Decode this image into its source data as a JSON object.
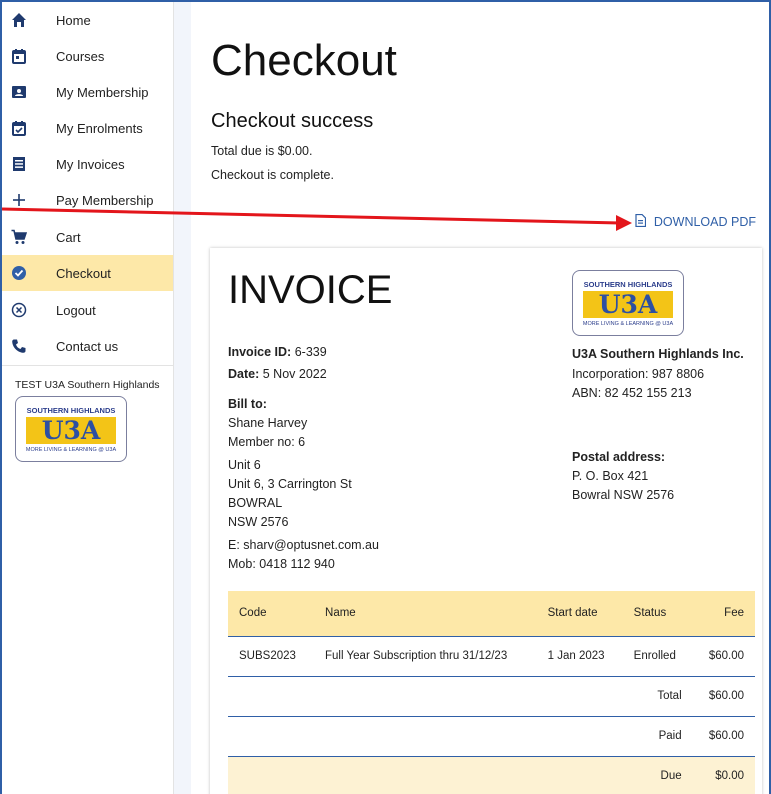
{
  "sidebar": {
    "items": [
      {
        "label": "Home",
        "icon": "home-icon"
      },
      {
        "label": "Courses",
        "icon": "calendar-icon"
      },
      {
        "label": "My Membership",
        "icon": "id-card-icon"
      },
      {
        "label": "My Enrolments",
        "icon": "calendar-check-icon"
      },
      {
        "label": "My Invoices",
        "icon": "receipt-icon"
      },
      {
        "label": "Pay Membership",
        "icon": "plus-icon"
      },
      {
        "label": "Cart",
        "icon": "cart-icon"
      },
      {
        "label": "Checkout",
        "icon": "check-circle-icon"
      },
      {
        "label": "Logout",
        "icon": "close-circle-icon"
      },
      {
        "label": "Contact us",
        "icon": "phone-icon"
      }
    ],
    "active": "Checkout",
    "org_name": "TEST U3A Southern Highlands"
  },
  "logo": {
    "top": "SOUTHERN HIGHLANDS",
    "mid": "U3A",
    "bottom": "MORE LIVING & LEARNING @ U3A"
  },
  "main": {
    "title": "Checkout",
    "subtitle": "Checkout success",
    "total_due": "Total due is $0.00.",
    "complete": "Checkout is complete.",
    "download_label": "DOWNLOAD PDF"
  },
  "invoice": {
    "title": "INVOICE",
    "id_label": "Invoice ID:",
    "id_value": "6-339",
    "date_label": "Date:",
    "date_value": "5 Nov 2022",
    "bill_to_label": "Bill to:",
    "bill_name": "Shane Harvey",
    "member_no": "Member no: 6",
    "addr1": "Unit 6",
    "addr2": "Unit 6, 3 Carrington St",
    "addr3": "BOWRAL",
    "addr4": "NSW 2576",
    "email": "E: sharv@optusnet.com.au",
    "mobile": "Mob: 0418 112 940",
    "org_name": "U3A Southern Highlands Inc.",
    "incorporation": "Incorporation: 987 8806",
    "abn": "ABN: 82 452 155 213",
    "postal_label": "Postal address:",
    "postal1": "P. O. Box 421",
    "postal2": "Bowral NSW 2576",
    "table": {
      "headers": [
        "Code",
        "Name",
        "Start date",
        "Status",
        "Fee"
      ],
      "rows": [
        {
          "code": "SUBS2023",
          "name": "Full Year Subscription thru 31/12/23",
          "start": "1 Jan 2023",
          "status": "Enrolled",
          "fee": "$60.00"
        }
      ],
      "total_label": "Total",
      "total_value": "$60.00",
      "paid_label": "Paid",
      "paid_value": "$60.00",
      "due_label": "Due",
      "due_value": "$0.00"
    }
  },
  "colors": {
    "accent": "#2f5fa7",
    "highlight": "#fde8a8",
    "arrow": "#e3151b"
  }
}
